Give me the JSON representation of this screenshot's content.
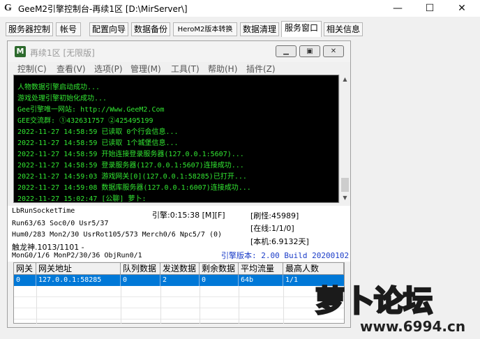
{
  "window": {
    "app_icon": "G",
    "title": "GeeM2引擎控制台-再续1区 [D:\\MirServer\\]",
    "controls": [
      "—",
      "☐",
      "✕"
    ]
  },
  "menu_tabs": [
    "服务器控制",
    "帐号",
    "配置向导",
    "数据备份",
    "HeroM2版本转换",
    "数据清理",
    "服务窗口",
    "相关信息"
  ],
  "active_tab": "服务窗口",
  "child_window": {
    "icon": "M",
    "title": "再续1区 [无限版]",
    "menu": [
      "控制(C)",
      "查看(V)",
      "选项(P)",
      "管理(M)",
      "工具(T)",
      "帮助(H)",
      "插件(Z)"
    ]
  },
  "console_lines": [
    "人物数据引擎启动成功...",
    "游戏处理引擎初始化成功...",
    "Gee引擎唯一网站: http://Www.GeeM2.Com",
    "GEE交流群: ①432631757   ②425495199",
    "2022-11-27 14:58:59 已读取 0个行会信息...",
    "2022-11-27 14:58:59 已读取 1个城堡信息...",
    "2022-11-27 14:58:59 开始连接登录服务器(127.0.0.1:5607)...",
    "2022-11-27 14:58:59 登录服务器(127.0.0.1:5607)连接成功...",
    "2022-11-27 14:59:03 游戏网关[0](127.0.0.1:58285)已打开...",
    "2022-11-27 14:59:08 数据库服务器(127.0.0.1:6007)连接成功...",
    "2022-11-27 15:02:47 [公聊] 萝卜:"
  ],
  "status": {
    "socket": "LbRunSocketTime",
    "engine_time": "引擎:0:15:38 [M][F]",
    "run": "Run63/63 Soc0/0 Usr5/37",
    "hum": "Hum0/283 Mon2/30 UsrRot105/573 Merch0/6 Npc5/7 (0)",
    "dragon": "触龙神.1013/1101 -",
    "mon": "MonG0/1/6 MonP2/30/36 ObjRun0/1",
    "refresh": "[刷怪:45989]",
    "online": "[在线:1/1/0]",
    "local": "[本机:6.9132天]",
    "version": "引擎版本: 2.00 Build 20200102"
  },
  "gateway_table": {
    "headers": [
      "网关",
      "网关地址",
      "队列数据",
      "发送数据",
      "剩余数据",
      "平均流量",
      "最高人数"
    ],
    "rows": [
      [
        "0",
        "127.0.0.1:58285",
        "0",
        "2",
        "0",
        "64b",
        "1/1"
      ]
    ]
  },
  "watermark": {
    "logo": "萝卜论坛",
    "url": "www.6994.cn"
  },
  "colors": {
    "console_bg": "#000000",
    "console_text": "#32e632",
    "selected_row": "#0078d7",
    "version_text": "#1a3cc8"
  }
}
